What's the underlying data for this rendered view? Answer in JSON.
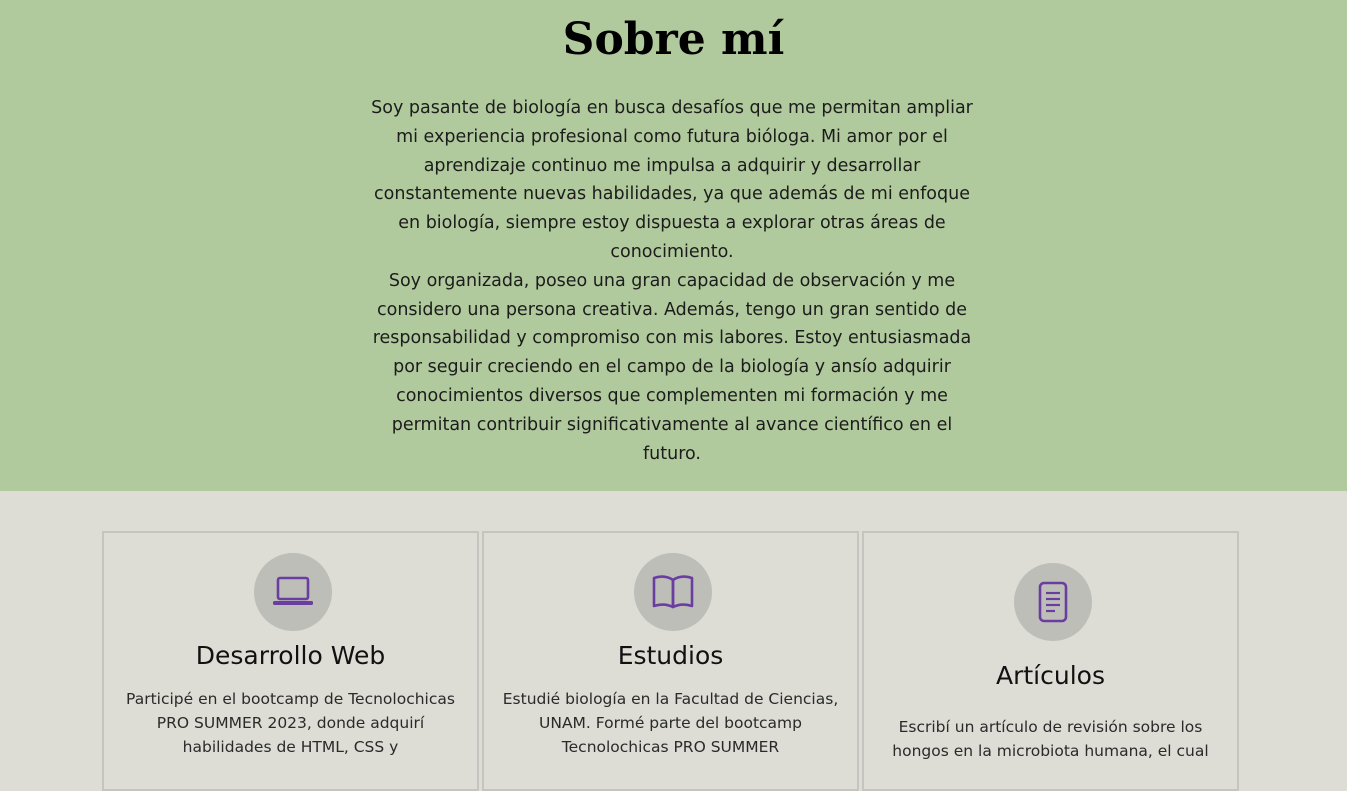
{
  "about": {
    "title": "Sobre mí",
    "paragraph_1": "Soy pasante de biología en busca desafíos que me permitan ampliar mi experiencia profesional como futura bióloga. Mi amor por el aprendizaje continuo me impulsa a adquirir y desarrollar constantemente nuevas habilidades, ya que además de mi enfoque en biología, siempre estoy dispuesta a explorar otras áreas de conocimiento.",
    "paragraph_2": "Soy organizada, poseo una gran capacidad de observación y me considero una persona creativa. Además, tengo un gran sentido de responsabilidad y compromiso con mis labores. Estoy entusiasmada por seguir creciendo en el campo de la biología y ansío adquirir conocimientos diversos que complementen mi formación y me permitan contribuir significativamente al avance científico en el futuro."
  },
  "cards": [
    {
      "icon": "laptop-icon",
      "title": "Desarrollo Web",
      "text": "Participé en el bootcamp de Tecnolochicas PRO SUMMER 2023, donde adquirí habilidades de HTML, CSS y"
    },
    {
      "icon": "book-icon",
      "title": "Estudios",
      "text": "Estudié biología en la Facultad de Ciencias, UNAM. Formé parte del bootcamp Tecnolochicas PRO SUMMER"
    },
    {
      "icon": "document-icon",
      "title": "Artículos",
      "text": "Escribí un artículo de revisión sobre los hongos en la microbiota humana, el cual"
    }
  ],
  "colors": {
    "about_background": "#b0c99d",
    "page_background": "#ddddd6",
    "icon_accent": "#6a3ea1",
    "icon_circle": "#bebeb9"
  }
}
